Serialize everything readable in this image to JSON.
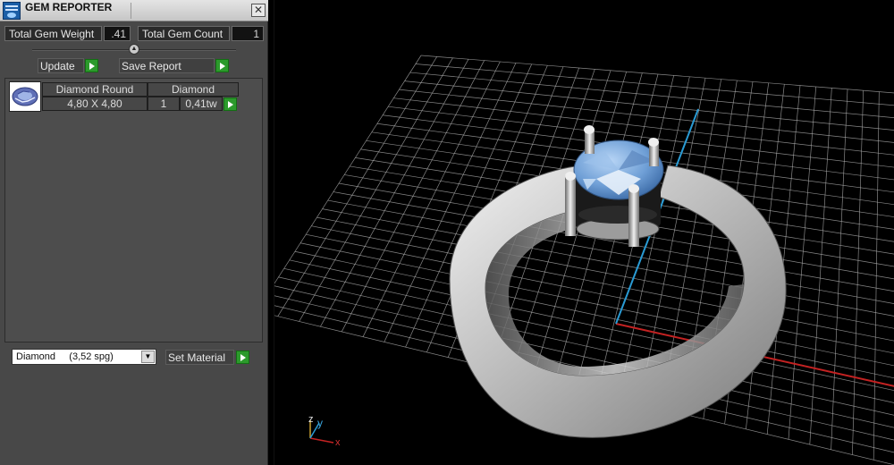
{
  "window": {
    "title": "GEM REPORTER",
    "close_glyph": "✕"
  },
  "summary": {
    "total_weight_label": "Total Gem Weight",
    "total_weight_value": ".41",
    "total_count_label": "Total Gem Count",
    "total_count_value": "1"
  },
  "buttons": {
    "update": "Update",
    "save_report": "Save Report",
    "set_material": "Set Material"
  },
  "gem_list": {
    "headers": [
      "Diamond Round",
      "Diamond"
    ],
    "rows": [
      {
        "size": "4,80 X 4,80",
        "count": "1",
        "weight": "0,41tw"
      }
    ]
  },
  "material": {
    "selected": "Diamond     (3,52 spg)"
  },
  "viewport": {
    "axis_labels": {
      "z": "z",
      "y": "y",
      "x": "x"
    },
    "colors": {
      "grid": "#b4b4b4",
      "x_axis": "#c42222",
      "y_axis": "#2a9bd4",
      "metal": "#c8c8c8",
      "gem": "#6f9fd6"
    }
  }
}
